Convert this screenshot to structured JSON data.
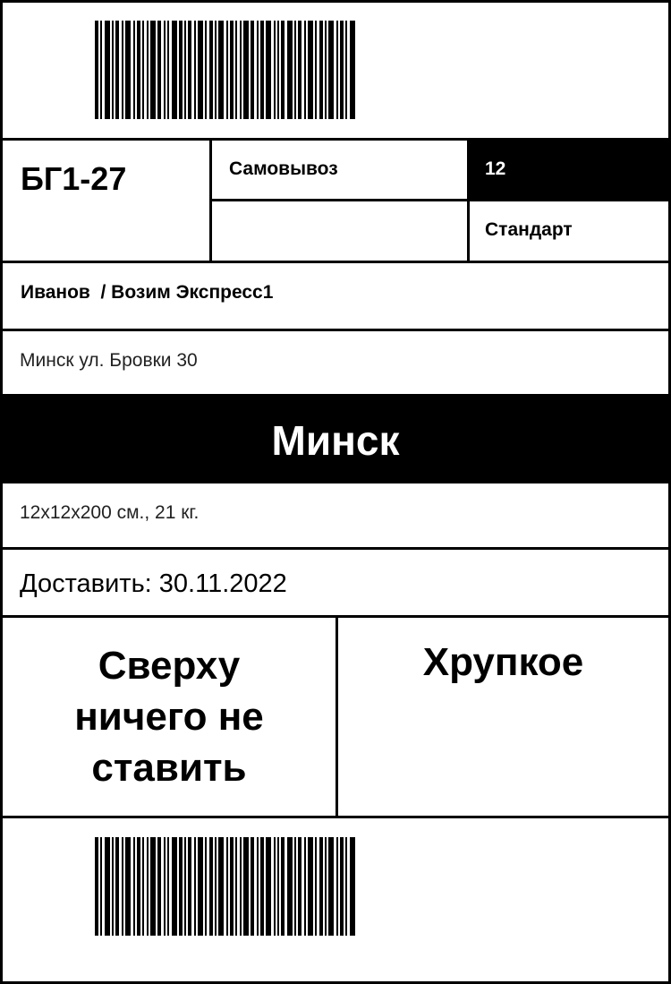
{
  "label": {
    "code": "БГ1-27",
    "delivery_method": "Самовывоз",
    "number": "12",
    "tariff": "Стандарт",
    "recipient": "Иванов  / Возим Экспресс1",
    "address": "Минск ул. Бровки 30",
    "city": "Минск",
    "dimensions": "12х12х200 см., 21 кг.",
    "deliver_by": "Доставить: 30.11.2022",
    "handling_1_lines": [
      "Сверху",
      "ничего не",
      "ставить"
    ],
    "handling_2": "Хрупкое"
  },
  "colors": {
    "ink": "#000000",
    "paper": "#ffffff"
  },
  "icons": {
    "barcode_top": "barcode-icon",
    "barcode_bottom": "barcode-icon"
  }
}
